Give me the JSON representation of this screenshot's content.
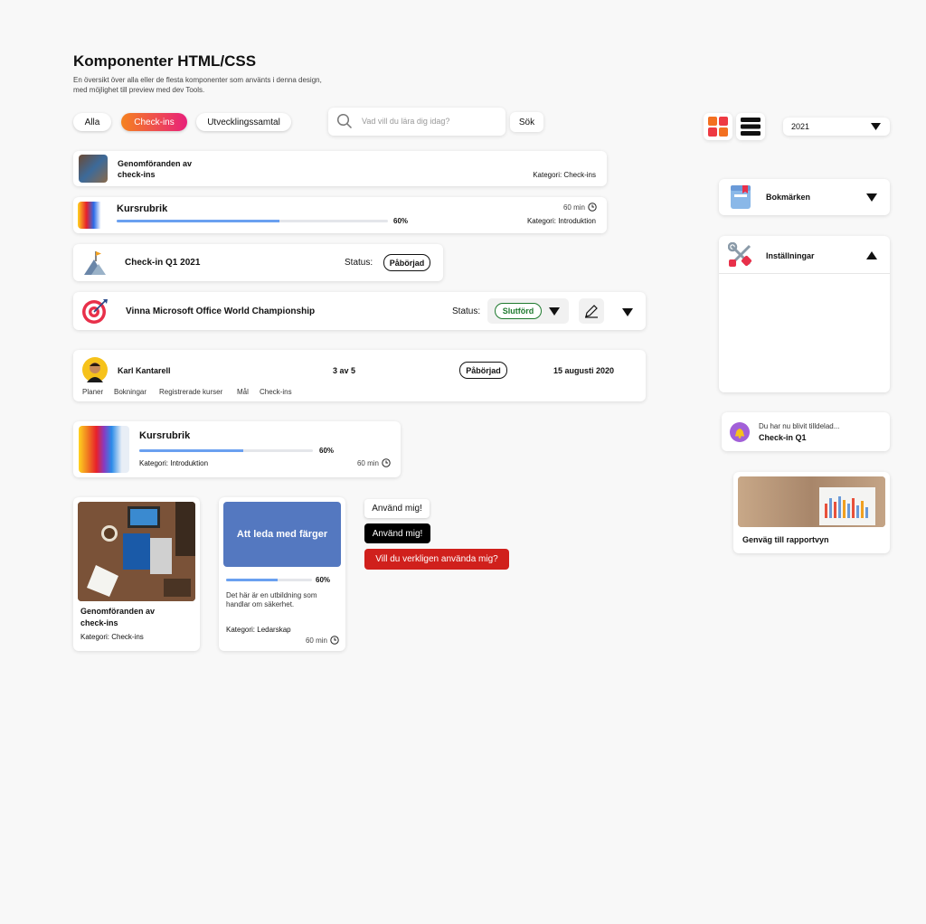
{
  "header": {
    "title": "Komponenter HTML/CSS",
    "desc1": "En översikt över alla eller de flesta komponenter som använts i denna design,",
    "desc2": "med möjlighet till preview med dev Tools."
  },
  "filters": {
    "all": "Alla",
    "checkins": "Check-ins",
    "dev": "Utvecklingssamtal"
  },
  "search": {
    "placeholder": "Vad vill du lära dig idag?",
    "button": "Sök"
  },
  "year_select": {
    "value": "2021"
  },
  "card1": {
    "title1": "Genomföranden av",
    "title2": "check-ins",
    "category": "Kategori: Check-ins"
  },
  "card2": {
    "title": "Kursrubrik",
    "duration": "60 min",
    "percent": "60%",
    "progress": 0.6,
    "category": "Kategori: Introduktion"
  },
  "card3": {
    "title": "Check-in Q1 2021",
    "status_label": "Status:",
    "status": "Påbörjad"
  },
  "card4": {
    "title": "Vinna Microsoft Office World Championship",
    "status_label": "Status:",
    "status": "Slutförd",
    "status_color": "#1e7a2e"
  },
  "person": {
    "name": "Karl Kantarell",
    "count": "3 av 5",
    "status": "Påbörjad",
    "date": "15 augusti 2020",
    "tabs": [
      "Planer",
      "Bokningar",
      "Registrerade kurser",
      "Mål",
      "Check-ins"
    ]
  },
  "course_card": {
    "title": "Kursrubrik",
    "percent": "60%",
    "progress": 0.6,
    "category": "Kategori: Introduktion",
    "duration": "60 min"
  },
  "tile1": {
    "title1": "Genomföranden av",
    "title2": "check-ins",
    "category": "Kategori: Check-ins"
  },
  "tile2": {
    "banner": "Att leda med färger",
    "banner_color": "#5478c0",
    "percent": "60%",
    "progress": 0.6,
    "desc1": "Det här är en utbildning som",
    "desc2": "handlar om säkerhet.",
    "category": "Kategori: Ledarskap",
    "duration": "60 min"
  },
  "buttons": {
    "light": "Använd mig!",
    "dark": "Använd mig!",
    "danger": "Vill du verkligen använda mig?",
    "danger_color": "#d0201c"
  },
  "sidebar": {
    "bookmarks": "Bokmärken",
    "settings": "Inställningar",
    "notice_line1": "Du har nu blivit tilldelad...",
    "notice_line2": "Check-in Q1",
    "report": "Genväg till rapportvyn"
  },
  "colors": {
    "accent_gradient_start": "#f5821f",
    "accent_gradient_end": "#e8207a",
    "progress": "#6aa0f0"
  }
}
